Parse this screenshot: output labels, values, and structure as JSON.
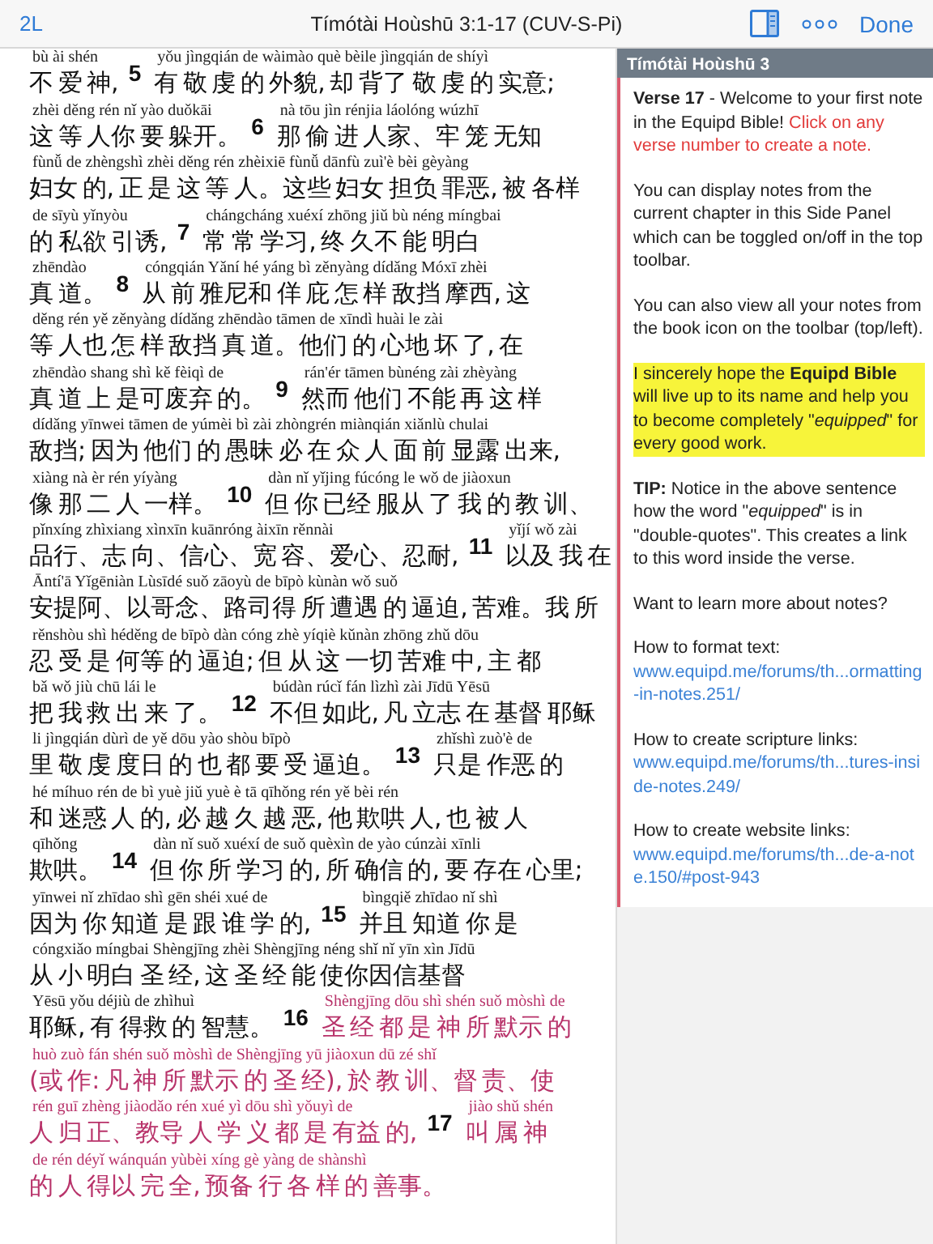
{
  "toolbar": {
    "left_link": "2L",
    "title": "Tímótài Hoùshū 3:1-17 (CUV-S-Pi)",
    "done": "Done"
  },
  "passage": {
    "rows": [
      {
        "segments": [
          {
            "kind": "words",
            "pinyin": "bù ài shén",
            "hanzi": "不 爱 神,",
            "red_letter": false
          },
          {
            "kind": "verse",
            "number": "5"
          },
          {
            "kind": "words",
            "pinyin": "yǒu jìngqián de wàimào què bèile jìngqián de shíyì",
            "hanzi": "有 敬 虔 的 外貌, 却 背了 敬 虔 的 实意;",
            "red_letter": false
          }
        ]
      },
      {
        "segments": [
          {
            "kind": "words",
            "pinyin": "zhèi děng rén nǐ yào duǒkāi",
            "hanzi": "这 等 人你 要 躲开。",
            "red_letter": false
          },
          {
            "kind": "verse",
            "number": "6"
          },
          {
            "kind": "words",
            "pinyin": "nà tōu jìn rénjia láolóng wúzhī",
            "hanzi": "那 偷 进 人家、牢 笼 无知",
            "red_letter": false
          }
        ]
      },
      {
        "segments": [
          {
            "kind": "words",
            "pinyin": "fùnǚ de zhèngshì zhèi děng rén zhèixiē fùnǚ dānfù zuì'è bèi gèyàng",
            "hanzi": "妇女 的, 正 是 这 等 人。这些 妇女 担负 罪恶, 被 各样",
            "red_letter": false
          }
        ]
      },
      {
        "segments": [
          {
            "kind": "words",
            "pinyin": "de sīyù yǐnyòu",
            "hanzi": "的 私欲 引诱,",
            "red_letter": false
          },
          {
            "kind": "verse",
            "number": "7"
          },
          {
            "kind": "words",
            "pinyin": "chángcháng xuéxí zhōng jiǔ bù néng míngbai",
            "hanzi": "常 常 学习, 终 久不 能 明白",
            "red_letter": false
          }
        ]
      },
      {
        "segments": [
          {
            "kind": "words",
            "pinyin": "zhēndào",
            "hanzi": "真 道。",
            "red_letter": false
          },
          {
            "kind": "verse",
            "number": "8"
          },
          {
            "kind": "words",
            "pinyin": "cóngqián Yǎní hé yáng bì zěnyàng dídǎng Móxī zhèi",
            "hanzi": "从 前 雅尼和 佯 庇 怎 样 敌挡 摩西, 这",
            "red_letter": false
          }
        ]
      },
      {
        "segments": [
          {
            "kind": "words",
            "pinyin": "děng rén yě zěnyàng dídǎng zhēndào tāmen de xīndì huài le zài",
            "hanzi": "等 人也 怎 样 敌挡 真 道。他们 的 心地 坏 了, 在",
            "red_letter": false
          }
        ]
      },
      {
        "segments": [
          {
            "kind": "words",
            "pinyin": "zhēndào shang shì kě fèiqì de",
            "hanzi": "真 道 上 是可废弃 的。",
            "red_letter": false
          },
          {
            "kind": "verse",
            "number": "9"
          },
          {
            "kind": "words",
            "pinyin": "rán'ér tāmen bùnéng zài zhèyàng",
            "hanzi": "然而 他们 不能 再 这 样",
            "red_letter": false
          }
        ]
      },
      {
        "segments": [
          {
            "kind": "words",
            "pinyin": "dídǎng yīnwei tāmen de yúmèi bì zài zhòngrén miànqián xiǎnlù chulai",
            "hanzi": "敌挡; 因为 他们 的 愚昧 必 在 众 人 面 前 显露 出来,",
            "red_letter": false
          }
        ]
      },
      {
        "segments": [
          {
            "kind": "words",
            "pinyin": "xiàng nà èr rén yíyàng",
            "hanzi": "像 那 二 人 一样。",
            "red_letter": false
          },
          {
            "kind": "verse",
            "number": "10"
          },
          {
            "kind": "words",
            "pinyin": "dàn nǐ yǐjing fúcóng le wǒ de jiàoxun",
            "hanzi": "但 你 已经 服从 了 我 的 教 训、",
            "red_letter": false
          }
        ]
      },
      {
        "segments": [
          {
            "kind": "words",
            "pinyin": "pǐnxíng zhìxiang xìnxīn kuānróng àixīn rěnnài",
            "hanzi": "品行、志 向、信心、宽 容、爱心、忍耐,",
            "red_letter": false
          },
          {
            "kind": "verse",
            "number": "11"
          },
          {
            "kind": "words",
            "pinyin": "yǐjí wǒ zài",
            "hanzi": "以及 我 在",
            "red_letter": false
          }
        ]
      },
      {
        "segments": [
          {
            "kind": "words",
            "pinyin": "Āntí'ā Yǐgēniàn Lùsīdé suǒ zāoyù de bīpò kùnàn wǒ suǒ",
            "hanzi": "安提阿、以哥念、路司得 所 遭遇 的 逼迫, 苦难。我 所",
            "red_letter": false
          }
        ]
      },
      {
        "segments": [
          {
            "kind": "words",
            "pinyin": "rěnshòu shì héděng de bīpò dàn cóng zhè yíqiè kǔnàn zhōng zhǔ dōu",
            "hanzi": "忍 受 是 何等 的 逼迫; 但 从 这 一切 苦难 中, 主 都",
            "red_letter": false
          }
        ]
      },
      {
        "segments": [
          {
            "kind": "words",
            "pinyin": "bǎ wǒ jiù chū lái le",
            "hanzi": "把 我 救 出 来 了。",
            "red_letter": false
          },
          {
            "kind": "verse",
            "number": "12"
          },
          {
            "kind": "words",
            "pinyin": "búdàn rúcǐ fán lìzhì zài Jīdū Yēsū",
            "hanzi": "不但 如此, 凡 立志 在 基督 耶稣",
            "red_letter": false
          }
        ]
      },
      {
        "segments": [
          {
            "kind": "words",
            "pinyin": "li jìngqián dùrì de yě dōu yào shòu bīpò",
            "hanzi": "里 敬 虔 度日 的 也 都 要 受 逼迫。",
            "red_letter": false
          },
          {
            "kind": "verse",
            "number": "13"
          },
          {
            "kind": "words",
            "pinyin": "zhǐshì zuò'è de",
            "hanzi": "只是 作恶 的",
            "red_letter": false
          }
        ]
      },
      {
        "segments": [
          {
            "kind": "words",
            "pinyin": "hé míhuo rén de bì yuè jiǔ yuè è tā qīhǒng rén yě bèi rén",
            "hanzi": "和 迷惑 人 的, 必 越 久 越 恶, 他 欺哄 人, 也 被 人",
            "red_letter": false
          }
        ]
      },
      {
        "segments": [
          {
            "kind": "words",
            "pinyin": "qīhǒng",
            "hanzi": "欺哄。",
            "red_letter": false
          },
          {
            "kind": "verse",
            "number": "14"
          },
          {
            "kind": "words",
            "pinyin": "dàn nǐ suǒ xuéxí de suǒ quèxìn de yào cúnzài xīnli",
            "hanzi": "但 你 所 学习 的, 所 确信 的, 要 存在 心里;",
            "red_letter": false
          }
        ]
      },
      {
        "segments": [
          {
            "kind": "words",
            "pinyin": "yīnwei nǐ zhīdao shì gēn shéi xué de",
            "hanzi": "因为 你 知道 是 跟 谁 学 的,",
            "red_letter": false
          },
          {
            "kind": "verse",
            "number": "15"
          },
          {
            "kind": "words",
            "pinyin": "bìngqiě zhīdao nǐ shì",
            "hanzi": "并且 知道 你 是",
            "red_letter": false
          }
        ]
      },
      {
        "segments": [
          {
            "kind": "words",
            "pinyin": "cóngxiǎo míngbai Shèngjīng zhèi Shèngjīng néng shǐ nǐ yīn xìn Jīdū",
            "hanzi": "从 小 明白 圣 经, 这 圣 经 能 使你因信基督",
            "red_letter": false
          }
        ]
      },
      {
        "segments": [
          {
            "kind": "words",
            "pinyin": "Yēsū yǒu déjiù de zhìhuì",
            "hanzi": "耶稣, 有 得救 的 智慧。",
            "red_letter": false
          },
          {
            "kind": "verse",
            "number": "16"
          },
          {
            "kind": "words",
            "pinyin": "Shèngjīng dōu shì shén suǒ mòshì de",
            "hanzi": "圣 经 都 是 神 所 默示 的",
            "red_letter": true
          }
        ]
      },
      {
        "segments": [
          {
            "kind": "words",
            "pinyin": "huò zuò fán shén suǒ mòshì de Shèngjīng yū jiàoxun dū zé shǐ",
            "hanzi": "(或 作: 凡 神 所 默示 的 圣 经), 於 教 训、督 责、使",
            "red_letter": true
          }
        ]
      },
      {
        "segments": [
          {
            "kind": "words",
            "pinyin": "rén guī zhèng jiàodǎo rén xué yì dōu shì yǒuyì de",
            "hanzi": "人 归 正、教导 人 学 义 都 是 有益 的,",
            "red_letter": true
          },
          {
            "kind": "verse",
            "number": "17"
          },
          {
            "kind": "words",
            "pinyin": "jiào shǔ shén",
            "hanzi": "叫 属 神",
            "red_letter": true
          }
        ]
      },
      {
        "segments": [
          {
            "kind": "words",
            "pinyin": "de rén déyǐ wánquán yùbèi xíng gè yàng de shànshì",
            "hanzi": "的 人 得以 完 全, 预备 行 各 样 的 善事。",
            "red_letter": true
          }
        ]
      }
    ]
  },
  "notes_panel": {
    "header": "Tímótài Hoùshū 3",
    "paragraphs": [
      {
        "kind": "text",
        "text": "**Verse 17** - Welcome to your first note in the Equipd Bible!",
        "hint": "Click on any verse number to create a note.",
        "highlighted": false
      },
      {
        "kind": "text",
        "text": "You can display notes from the current chapter in this Side Panel which can be toggled on/off in the top toolbar.",
        "highlighted": false
      },
      {
        "kind": "text",
        "text": "You can also view all your notes from the book icon on the toolbar (top/left).",
        "highlighted": false
      },
      {
        "kind": "text",
        "text": "I sincerely hope the **Equipd Bible** will live up to its name and help you to become completely \"*equipped*\" for every good work.",
        "highlighted": true
      },
      {
        "kind": "text",
        "text": "**TIP:** Notice in the above sentence how the word \"*equipped*\" is in \"double-quotes\". This creates a link to this word inside the verse.",
        "highlighted": false
      },
      {
        "kind": "text",
        "text": "Want to learn more about notes?",
        "highlighted": false
      },
      {
        "kind": "link",
        "text": "How to format text:",
        "url": "www.equipd.me/forums/th...ormatting-in-notes.251/"
      },
      {
        "kind": "link",
        "text": "How to create scripture links:",
        "url": "www.equipd.me/forums/th...tures-inside-notes.249/"
      },
      {
        "kind": "link",
        "text": "How to create website links:",
        "url": "www.equipd.me/forums/th...de-a-note.150/#post-943"
      }
    ]
  }
}
